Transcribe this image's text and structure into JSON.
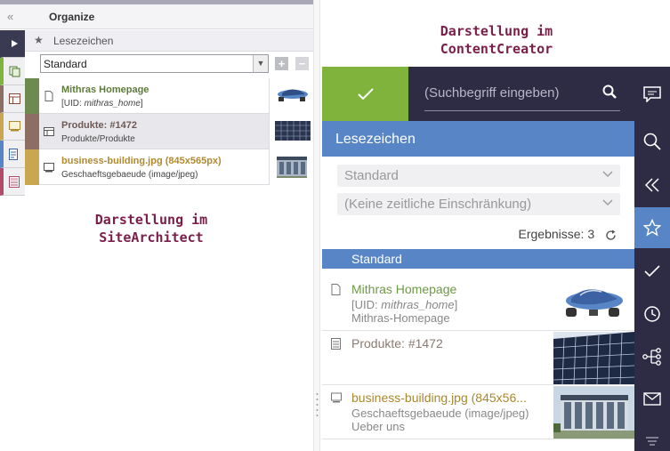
{
  "site_architect": {
    "collapse_icon": "double-chevron-left-icon",
    "header_title": "Organize",
    "bookmarks_title": "Lesezeichen",
    "select_value": "Standard",
    "add_label": "+",
    "remove_label": "−",
    "items": [
      {
        "title": "Mithras Homepage",
        "subtitle_prefix": "[UID: ",
        "subtitle_uid": "mithras_home",
        "subtitle_suffix": "]",
        "icon": "page-icon",
        "color": "#6e8a50",
        "text_color": "#5d7b3a"
      },
      {
        "title": "Produkte: #1472",
        "subtitle": "Produkte/Produkte",
        "icon": "dataset-icon",
        "color": "#8d6e63",
        "text_color": "#6d5a55"
      },
      {
        "title": "business-building.jpg (845x565px)",
        "subtitle": "Geschaeftsgebaeude (image/jpeg)",
        "icon": "image-icon",
        "color": "#c9a64f",
        "text_color": "#b08a2e"
      }
    ],
    "caption_line1": "Darstellung im",
    "caption_line2": "SiteArchitect"
  },
  "content_creator": {
    "caption_line1": "Darstellung im",
    "caption_line2": "ContentCreator",
    "search_placeholder": "(Suchbegriff eingeben)",
    "panel_title": "Lesezeichen",
    "dropdown1": "Standard",
    "dropdown2": "(Keine zeitliche Einschränkung)",
    "results_label": "Ergebnisse: 3",
    "group_label": "Standard",
    "items": [
      {
        "title": "Mithras Homepage",
        "line2_prefix": "[UID: ",
        "line2_uid": "mithras_home",
        "line2_suffix": "]",
        "line3": "Mithras-Homepage",
        "color": "#6e9a45"
      },
      {
        "title": "Produkte: #1472",
        "color": "#8a7a70"
      },
      {
        "title": "business-building.jpg (845x56...",
        "line2": "Geschaeftsgebaeude (image/jpeg)",
        "line3": "Ueber uns",
        "color": "#a8882e"
      }
    ],
    "rail_icons": [
      "comment-icon",
      "search-icon",
      "double-chevron-left-icon",
      "star-icon",
      "check-icon",
      "clock-icon",
      "sitemap-icon",
      "mail-icon",
      "filter-list-icon"
    ]
  },
  "colors": {
    "accent_blue": "#5785c5",
    "dark_bar": "#2e2c44",
    "check_green": "#7fb33c",
    "caption": "#7a1f4a"
  }
}
